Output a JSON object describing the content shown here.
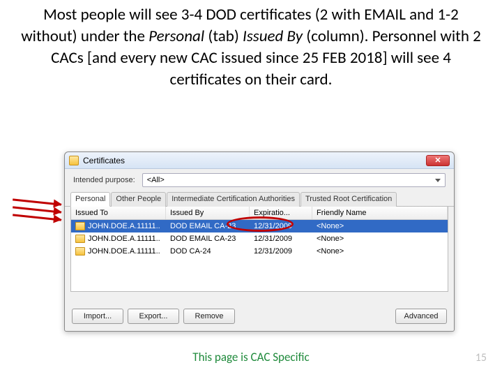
{
  "slide": {
    "text_pre": "Most people will see 3-4 DOD certificates (2 with EMAIL and 1-2 without) under the ",
    "em1": "Personal",
    "text_mid1": " (tab) ",
    "em2": "Issued  By",
    "text_mid2": " (column). Personnel with 2 CACs [and every new CAC issued since 25 FEB 2018] will see 4 certificates on their card.",
    "footer": "This page is CAC Specific",
    "pagenum": "15"
  },
  "dialog": {
    "title": "Certificates",
    "purpose_label": "Intended purpose:",
    "purpose_value": "<All>",
    "tabs": [
      "Personal",
      "Other People",
      "Intermediate Certification Authorities",
      "Trusted Root Certification"
    ],
    "columns": [
      "Issued To",
      "Issued By",
      "Expiratio...",
      "Friendly Name"
    ],
    "rows": [
      {
        "to": "JOHN.DOE.A.11111..",
        "by": "DOD EMAIL CA-23",
        "exp": "12/31/2009",
        "fn": "<None>",
        "selected": true
      },
      {
        "to": "JOHN.DOE.A.11111..",
        "by": "DOD EMAIL CA-23",
        "exp": "12/31/2009",
        "fn": "<None>",
        "selected": false
      },
      {
        "to": "JOHN.DOE.A.11111..",
        "by": "DOD CA-24",
        "exp": "12/31/2009",
        "fn": "<None>",
        "selected": false
      }
    ],
    "buttons": {
      "import": "Import...",
      "export": "Export...",
      "remove": "Remove",
      "advanced": "Advanced"
    }
  }
}
